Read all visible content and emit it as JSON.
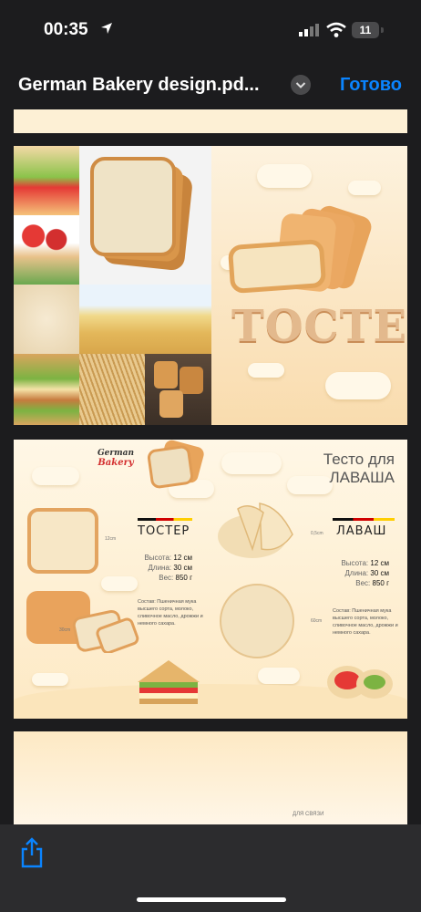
{
  "status": {
    "time": "00:35",
    "battery": "11"
  },
  "navbar": {
    "title": "German Bakery design.pd...",
    "done": "Готово"
  },
  "page3": {
    "logo_top": "German",
    "logo_bottom": "Bakery",
    "heading_line1": "Тесто для",
    "heading_line2": "ЛАВАША",
    "left": {
      "name": "ТОСТЕР",
      "h_label": "Высота:",
      "h_value": "12 см",
      "l_label": "Длина:",
      "l_value": "30 см",
      "w_label": "Вес:",
      "w_value": "850 г",
      "composition": "Состав: Пшеничная мука высшего сорта, молоко, сливочное масло, дрожжи и немного сахара.",
      "dim_side": "12cm",
      "dim_bottom": "30cm"
    },
    "right": {
      "name": "ЛАВАШ",
      "h_label": "Высота:",
      "h_value": "12 см",
      "l_label": "Длина:",
      "l_value": "30 см",
      "w_label": "Вес:",
      "w_value": "850 г",
      "composition": "Состав: Пшеничная мука высшего сорта, молоко, сливочное масло, дрожжи и немного сахара.",
      "dim_top": "0,5cm",
      "dim_side": "60cm"
    }
  },
  "page2": {
    "banner": "ТОСТЕР"
  },
  "page4": {
    "contact": "ДЛЯ СВЯЗИ"
  },
  "colors": {
    "accent": "#0a84ff",
    "flag_black": "#111111",
    "flag_red": "#d00000",
    "flag_gold": "#ffce00"
  }
}
